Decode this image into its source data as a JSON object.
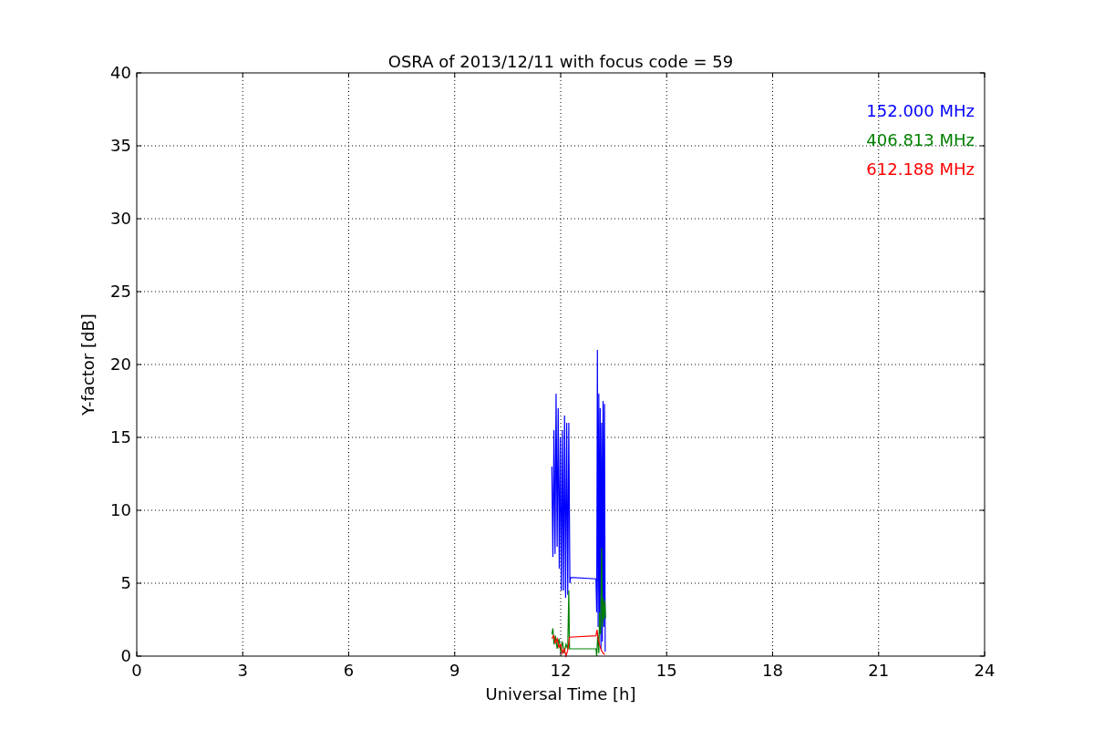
{
  "chart_data": {
    "type": "line",
    "title": "OSRA of 2013/12/11 with focus code = 59",
    "xlabel": "Universal Time [h]",
    "ylabel": "Y-factor [dB]",
    "xlim": [
      0,
      24
    ],
    "ylim": [
      0,
      40
    ],
    "xticks": [
      0,
      3,
      6,
      9,
      12,
      15,
      18,
      21,
      24
    ],
    "yticks": [
      0,
      5,
      10,
      15,
      20,
      25,
      30,
      35,
      40
    ],
    "grid": true,
    "series": [
      {
        "name": "152.000 MHz",
        "color": "#0000ff",
        "x": [
          11.75,
          11.78,
          11.81,
          11.84,
          11.87,
          11.9,
          11.93,
          11.96,
          11.99,
          12.02,
          12.05,
          12.08,
          12.11,
          12.14,
          12.17,
          12.2,
          12.23,
          12.26,
          12.28,
          13.0,
          13.02,
          13.04,
          13.06,
          13.08,
          13.1,
          13.12,
          13.14,
          13.16,
          13.18,
          13.2,
          13.22,
          13.24,
          13.26
        ],
        "values": [
          13,
          6.8,
          15.5,
          7,
          18,
          7.5,
          17,
          6,
          15,
          4.5,
          15.5,
          4.5,
          16.5,
          4,
          16,
          4.2,
          16,
          5,
          5.4,
          5.3,
          3,
          21,
          2,
          18,
          1.5,
          17,
          0.5,
          16,
          1,
          17.5,
          2,
          17.3,
          0.3
        ]
      },
      {
        "name": "406.813 MHz",
        "color": "#008000",
        "x": [
          11.75,
          11.78,
          11.81,
          11.85,
          11.9,
          11.95,
          12.0,
          12.05,
          12.1,
          12.15,
          12.2,
          12.23,
          12.25,
          13.0,
          13.02,
          13.05,
          13.08,
          13.1,
          13.13,
          13.16,
          13.18,
          13.2,
          13.22,
          13.25,
          13.27
        ],
        "values": [
          1.5,
          1.9,
          0.8,
          1.4,
          0.5,
          1.2,
          0.3,
          1,
          0.2,
          0.8,
          0.5,
          4.5,
          0.5,
          0.5,
          0,
          1.5,
          0.2,
          3,
          1.5,
          7.4,
          2,
          4,
          2.5,
          3.8,
          2.6
        ]
      },
      {
        "name": "612.188 MHz",
        "color": "#ff0000",
        "x": [
          11.75,
          11.8,
          11.85,
          11.9,
          11.95,
          12.0,
          12.05,
          12.1,
          12.15,
          12.2,
          12.25,
          13.0,
          13.03,
          13.06,
          13.1,
          13.15,
          13.2,
          13.25
        ],
        "values": [
          1.2,
          1.4,
          0.9,
          1.2,
          0.6,
          0.8,
          0.2,
          0.5,
          0,
          0.4,
          1.3,
          1.4,
          1.8,
          1.2,
          0.8,
          0.4,
          0.2,
          0.1
        ]
      }
    ]
  }
}
